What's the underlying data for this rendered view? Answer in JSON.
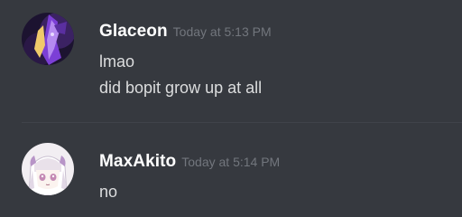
{
  "messages": [
    {
      "username": "Glaceon",
      "timestamp": "Today at 5:13 PM",
      "lines": [
        "lmao",
        "did bopit grow up at all"
      ],
      "avatar_icon": "purple-character-avatar"
    },
    {
      "username": "MaxAkito",
      "timestamp": "Today at 5:14 PM",
      "lines": [
        "no"
      ],
      "avatar_icon": "anime-girl-avatar"
    }
  ],
  "colors": {
    "background": "#36393f",
    "username": "#ffffff",
    "timestamp": "#72767d",
    "message_text": "#dcddde",
    "divider": "#40434a"
  }
}
